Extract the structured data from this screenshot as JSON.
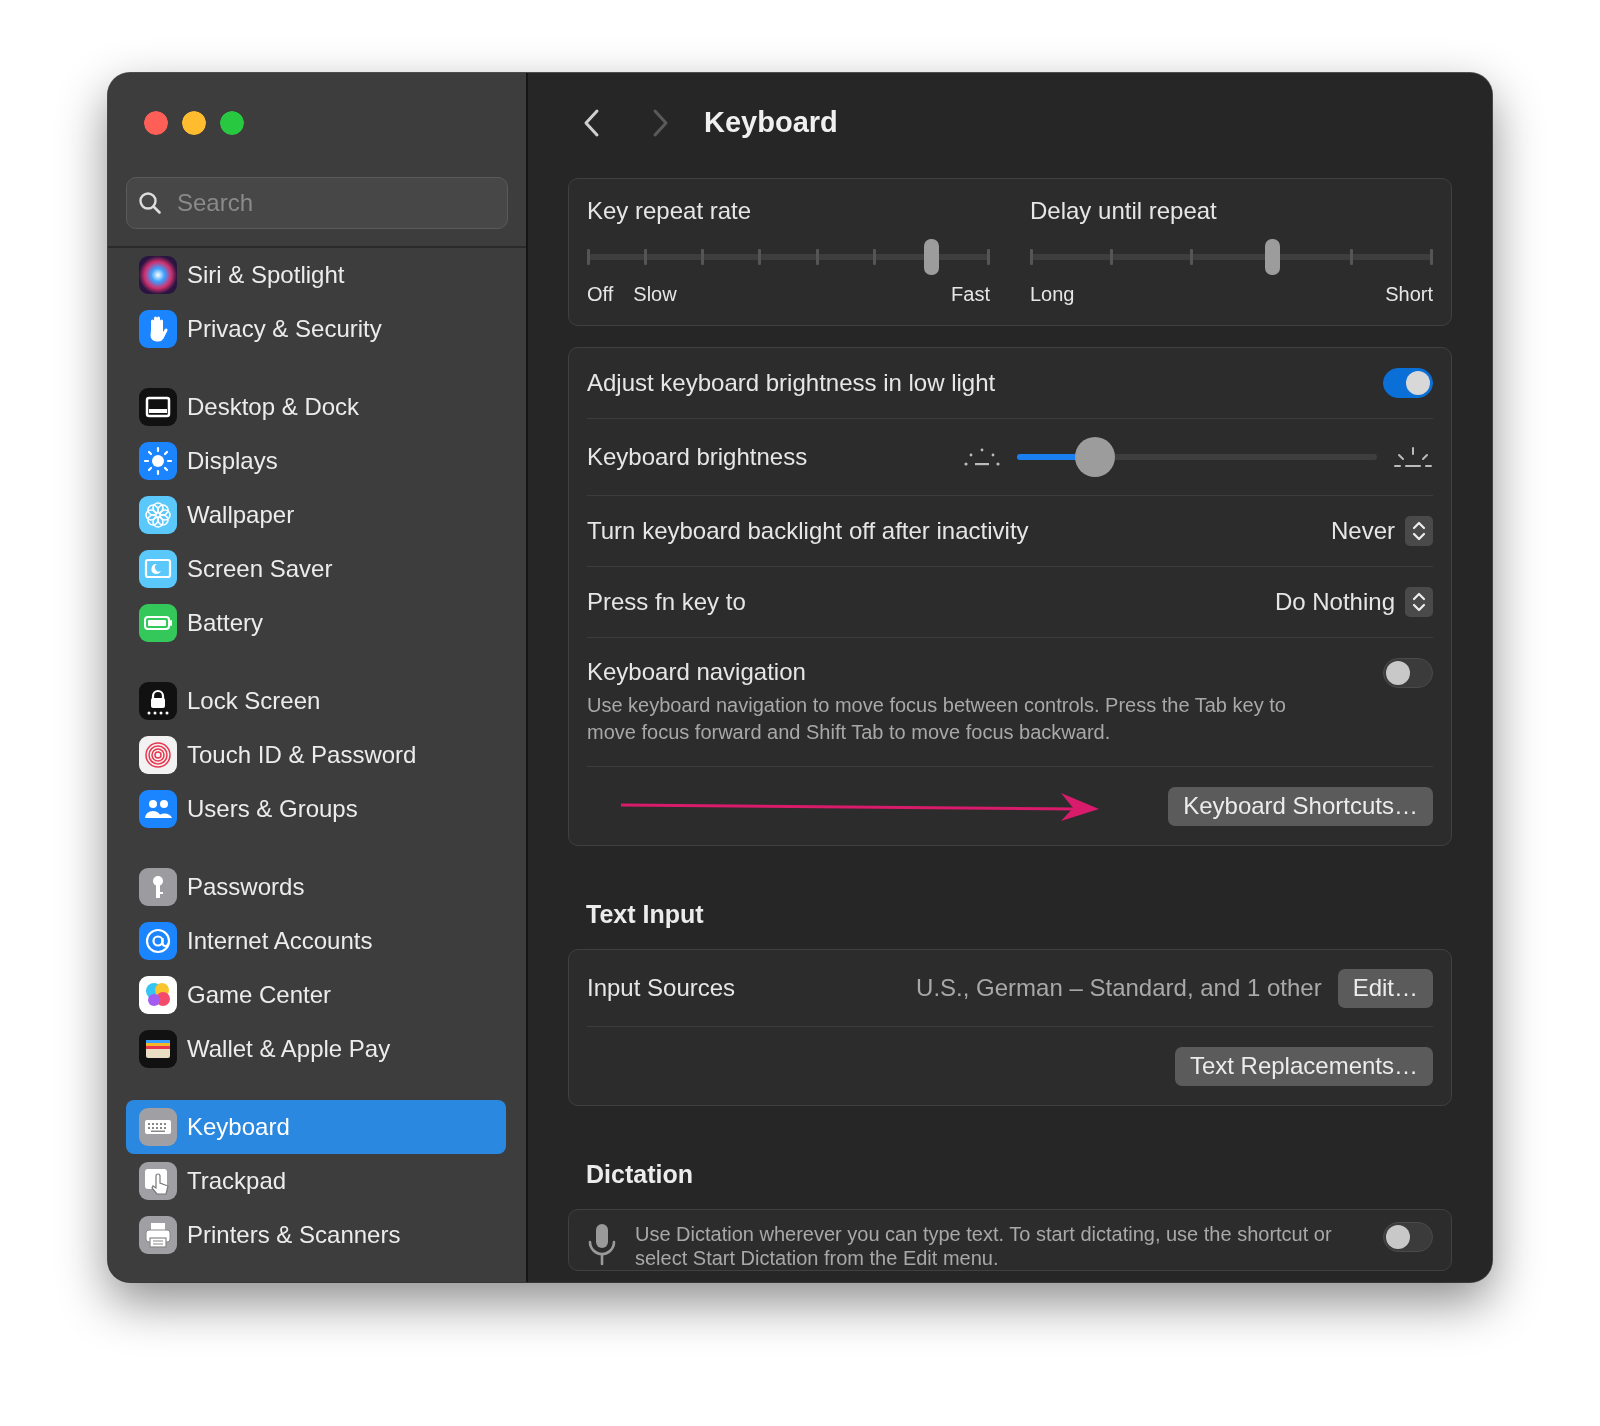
{
  "sidebar": {
    "search": {
      "placeholder": "Search"
    },
    "groups": [
      {
        "items": [
          {
            "label": "Siri & Spotlight",
            "selected": false
          },
          {
            "label": "Privacy & Security",
            "selected": false
          }
        ]
      },
      {
        "items": [
          {
            "label": "Desktop & Dock",
            "selected": false
          },
          {
            "label": "Displays",
            "selected": false
          },
          {
            "label": "Wallpaper",
            "selected": false
          },
          {
            "label": "Screen Saver",
            "selected": false
          },
          {
            "label": "Battery",
            "selected": false
          }
        ]
      },
      {
        "items": [
          {
            "label": "Lock Screen",
            "selected": false
          },
          {
            "label": "Touch ID & Password",
            "selected": false
          },
          {
            "label": "Users & Groups",
            "selected": false
          }
        ]
      },
      {
        "items": [
          {
            "label": "Passwords",
            "selected": false
          },
          {
            "label": "Internet Accounts",
            "selected": false
          },
          {
            "label": "Game Center",
            "selected": false
          },
          {
            "label": "Wallet & Apple Pay",
            "selected": false
          }
        ]
      },
      {
        "items": [
          {
            "label": "Keyboard",
            "selected": true
          },
          {
            "label": "Trackpad",
            "selected": false
          },
          {
            "label": "Printers & Scanners",
            "selected": false
          }
        ]
      }
    ]
  },
  "header": {
    "back_enabled": true,
    "forward_enabled": false,
    "title": "Keyboard"
  },
  "repeat": {
    "sliders": [
      {
        "kind": "rate",
        "label": "Key repeat rate",
        "level": 0.857,
        "scale_labels": [
          "Off",
          "Slow",
          "Fast"
        ]
      },
      {
        "kind": "delay",
        "label": "Delay until repeat",
        "level": 0.6,
        "scale_labels": [
          "Long",
          "Short"
        ]
      }
    ]
  },
  "keyboard_settings": {
    "rows": [
      {
        "kind": "toggle",
        "label": "Adjust keyboard brightness in low light",
        "on": true
      },
      {
        "kind": "slider",
        "label": "Keyboard brightness",
        "level": 0.18
      },
      {
        "kind": "popup",
        "label": "Turn keyboard backlight off after inactivity",
        "value": "Never"
      },
      {
        "kind": "popup",
        "label": "Press fn key to",
        "value": "Do Nothing"
      },
      {
        "kind": "toggle",
        "label": "Keyboard navigation",
        "description": "Use keyboard navigation to move focus between controls. Press the Tab key to move focus forward and Shift Tab to move focus backward.",
        "on": false
      },
      {
        "kind": "button",
        "button": "Keyboard Shortcuts…",
        "annotation_arrow": true
      }
    ]
  },
  "text_input": {
    "heading": "Text Input",
    "rows": [
      {
        "kind": "info",
        "label": "Input Sources",
        "value": "U.S., German – Standard, and 1 other",
        "button": "Edit…"
      },
      {
        "kind": "button",
        "button": "Text Replacements…"
      }
    ]
  },
  "dictation": {
    "heading": "Dictation",
    "description": "Use Dictation wherever you can type text. To start dictating, use the shortcut or select Start Dictation from the Edit menu.",
    "on": false
  }
}
